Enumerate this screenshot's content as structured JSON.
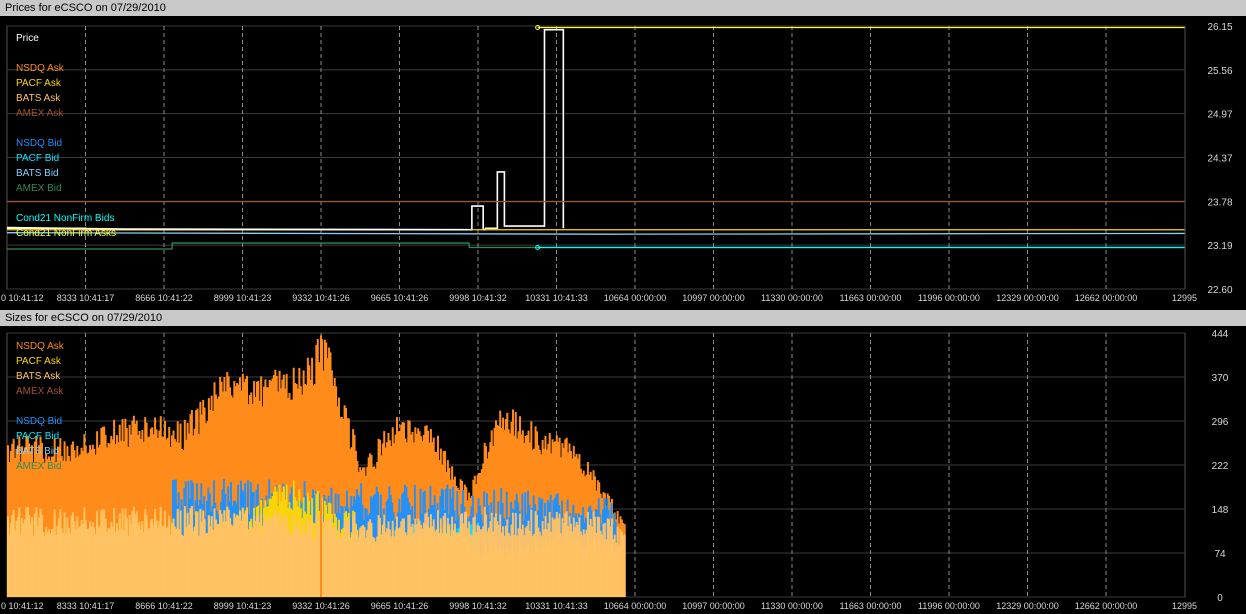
{
  "price_panel": {
    "title": "Prices for  eCSCO  on  07/29/2010"
  },
  "size_panel": {
    "title": "Sizes for  eCSCO  on  07/29/2010"
  },
  "colors": {
    "nsdq_ask": "#ff8c1a",
    "pacf_ask": "#ffd700",
    "bats_ask": "#ffc266",
    "amex_ask": "#a0522d",
    "nsdq_bid": "#1e90ff",
    "pacf_bid": "#00e5ff",
    "bats_bid": "#87cefa",
    "amex_bid": "#2e8b57",
    "cond21_bids": "#00ffff",
    "cond21_asks": "#ffff33",
    "price": "#ffffff"
  },
  "chart_data": [
    {
      "type": "line",
      "title": "Prices for  eCSCO  on  07/29/2010",
      "ylim": [
        22.6,
        26.15
      ],
      "y_ticks": [
        "26.15",
        "25.56",
        "24.97",
        "24.37",
        "23.78",
        "23.19",
        "22.60"
      ],
      "x_ticks": [
        "0 10:41:12",
        "8333 10:41:17",
        "8666 10:41:22",
        "8999 10:41:23",
        "9332 10:41:26",
        "9665 10:41:26",
        "9998 10:41:32",
        "10331 10:41:33",
        "10664 00:00:00",
        "10997 00:00:00",
        "11330 00:00:00",
        "11663 00:00:00",
        "11996 00:00:00",
        "12329 00:00:00",
        "12662 00:00:00",
        "12995"
      ],
      "legend": [
        "Price",
        "NSDQ Ask",
        "PACF Ask",
        "BATS Ask",
        "AMEX Ask",
        "NSDQ Bid",
        "PACF Bid",
        "BATS Bid",
        "AMEX Bid",
        "Cond21 NonFirm Bids",
        "Cond21 NonFirm Asks"
      ],
      "series": [
        {
          "name": "Price",
          "x": [
            0,
            8333,
            9970,
            9972,
            10020,
            10030,
            10080,
            10110,
            10270,
            10280,
            10360
          ],
          "y": [
            23.42,
            23.4,
            23.4,
            23.72,
            23.4,
            23.42,
            24.18,
            23.45,
            23.45,
            26.1,
            23.42
          ]
        },
        {
          "name": "AMEX Ask",
          "x": [
            0,
            12995
          ],
          "y": [
            23.78,
            23.78
          ]
        },
        {
          "name": "AMEX Bid",
          "x": [
            0,
            8700,
            8701,
            9960,
            9961,
            12995
          ],
          "y": [
            23.14,
            23.14,
            23.22,
            23.22,
            23.16,
            23.16
          ]
        },
        {
          "name": "Cond21 NonFirm Asks",
          "x": [
            10251,
            12995
          ],
          "y": [
            26.13,
            26.13
          ]
        },
        {
          "name": "Cond21 NonFirm Bids",
          "x": [
            10251,
            12995
          ],
          "y": [
            23.16,
            23.16
          ]
        },
        {
          "name": "BATS Bid",
          "x": [
            0,
            10560,
            12995
          ],
          "y": [
            23.36,
            23.34,
            23.35
          ]
        },
        {
          "name": "PACF Ask",
          "x": [
            0,
            10560,
            11500,
            12995
          ],
          "y": [
            23.4,
            23.4,
            23.4,
            23.4
          ]
        }
      ]
    },
    {
      "type": "bar",
      "title": "Sizes for  eCSCO  on  07/29/2010",
      "ylim": [
        0,
        444
      ],
      "y_ticks": [
        "444",
        "370",
        "296",
        "222",
        "148",
        "74",
        "0"
      ],
      "x_ticks": [
        "0 10:41:12",
        "8333 10:41:17",
        "8666 10:41:22",
        "8999 10:41:23",
        "9332 10:41:26",
        "9665 10:41:26",
        "9998 10:41:32",
        "10331 10:41:33",
        "10664 00:00:00",
        "10997 00:00:00",
        "11330 00:00:00",
        "11663 00:00:00",
        "11996 00:00:00",
        "12329 00:00:00",
        "12662 00:00:00",
        "12995"
      ],
      "legend": [
        "NSDQ Ask",
        "PACF Ask",
        "BATS Ask",
        "AMEX Ask",
        "NSDQ Bid",
        "PACF Bid",
        "BATS Bid",
        "AMEX Bid"
      ],
      "series": [
        {
          "name": "NSDQ Ask",
          "x": [
            8000,
            8150,
            8300,
            8450,
            8600,
            8750,
            8900,
            9050,
            9200,
            9350,
            9500,
            9650,
            9800,
            9950,
            10100,
            10250,
            10400,
            10550,
            10620
          ],
          "y": [
            263,
            265,
            262,
            292,
            300,
            290,
            370,
            375,
            380,
            440,
            222,
            300,
            280,
            180,
            330,
            280,
            260,
            170,
            128
          ]
        },
        {
          "name": "PACF Ask",
          "x": [
            8000,
            8500,
            9000,
            9200,
            9500,
            9700,
            9900,
            10000,
            10200,
            10400,
            10600
          ],
          "y": [
            140,
            135,
            150,
            200,
            130,
            110,
            130,
            90,
            100,
            110,
            90
          ]
        },
        {
          "name": "BATS Ask",
          "x": [
            8000,
            8500,
            9000,
            9500,
            10000,
            10500,
            10620
          ],
          "y": [
            145,
            145,
            148,
            130,
            145,
            140,
            120
          ]
        },
        {
          "name": "NSDQ Bid",
          "x": [
            8700,
            9960,
            10580
          ],
          "y": [
            192,
            180,
            158
          ]
        },
        {
          "name": "PACF Bid",
          "x": [
            9640,
            9850,
            10000
          ],
          "y": [
            120,
            110,
            120
          ]
        }
      ]
    }
  ]
}
